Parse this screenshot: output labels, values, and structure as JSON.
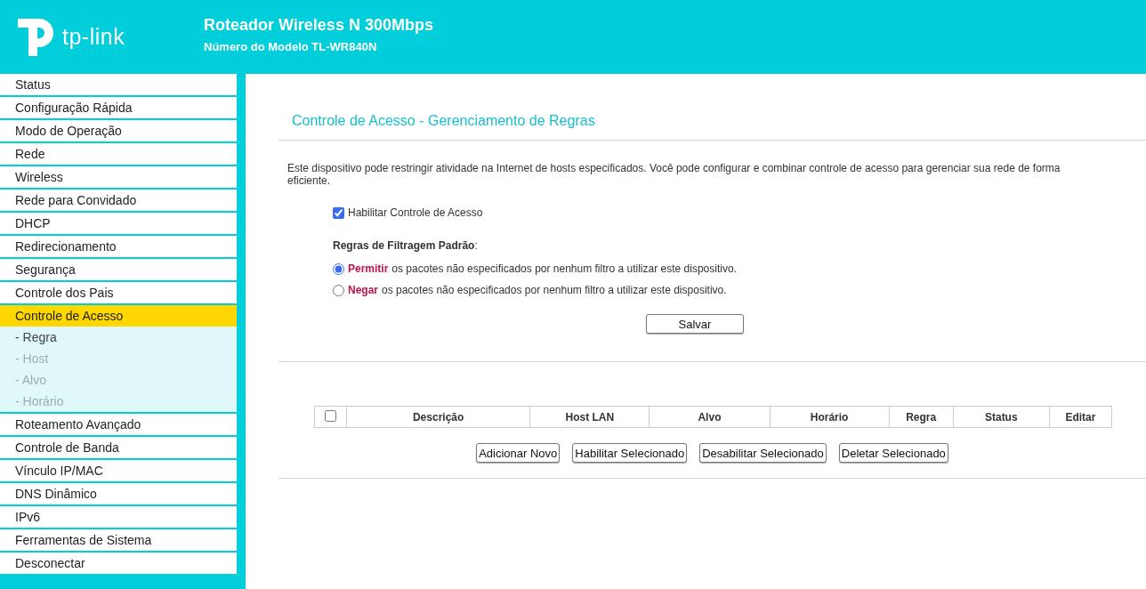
{
  "header": {
    "logo_text": "tp-link",
    "title": "Roteador Wireless N 300Mbps",
    "model": "Número do Modelo TL-WR840N"
  },
  "sidebar": {
    "items": [
      {
        "label": "Status",
        "selected": false
      },
      {
        "label": "Configuração Rápida",
        "selected": false
      },
      {
        "label": "Modo de Operação",
        "selected": false
      },
      {
        "label": "Rede",
        "selected": false
      },
      {
        "label": "Wireless",
        "selected": false
      },
      {
        "label": "Rede para Convidado",
        "selected": false
      },
      {
        "label": "DHCP",
        "selected": false
      },
      {
        "label": "Redirecionamento",
        "selected": false
      },
      {
        "label": "Segurança",
        "selected": false
      },
      {
        "label": "Controle dos Pais",
        "selected": false
      },
      {
        "label": "Controle de Acesso",
        "selected": true,
        "children": [
          {
            "label": "- Regra",
            "selected": true
          },
          {
            "label": "- Host",
            "selected": false
          },
          {
            "label": "- Alvo",
            "selected": false
          },
          {
            "label": "- Horário",
            "selected": false
          }
        ]
      },
      {
        "label": "Roteamento Avançado",
        "selected": false
      },
      {
        "label": "Controle de Banda",
        "selected": false
      },
      {
        "label": "Vínculo IP/MAC",
        "selected": false
      },
      {
        "label": "DNS Dinâmico",
        "selected": false
      },
      {
        "label": "IPv6",
        "selected": false
      },
      {
        "label": "Ferramentas de Sistema",
        "selected": false
      },
      {
        "label": "Desconectar",
        "selected": false
      }
    ]
  },
  "page_title": "Controle de Acesso - Gerenciamento de Regras",
  "description": "Este dispositivo pode restringir atividade na Internet de hosts especificados. Você pode configurar e combinar controle de acesso para gerenciar sua rede de forma eficiente.",
  "enable_checkbox": {
    "label": "Habilitar Controle de Acesso",
    "checked": true
  },
  "filter_rules": {
    "label": "Regras de Filtragem Padrão",
    "colon": ":",
    "options": [
      {
        "keyword": "Permitir",
        "text": "os pacotes não especificados por nenhum filtro a utilizar este dispositivo.",
        "selected": true
      },
      {
        "keyword": "Negar",
        "text": "os pacotes não especificados por nenhum filtro a utilizar este dispositivo.",
        "selected": false
      }
    ]
  },
  "save_button": "Salvar",
  "table": {
    "select_all_checked": false,
    "columns": [
      "Descrição",
      "Host LAN",
      "Alvo",
      "Horário",
      "Regra",
      "Status",
      "Editar"
    ]
  },
  "buttons": [
    "Adicionar Novo",
    "Habilitar Selecionado",
    "Desabilitar Selecionado",
    "Deletar Selecionado"
  ]
}
